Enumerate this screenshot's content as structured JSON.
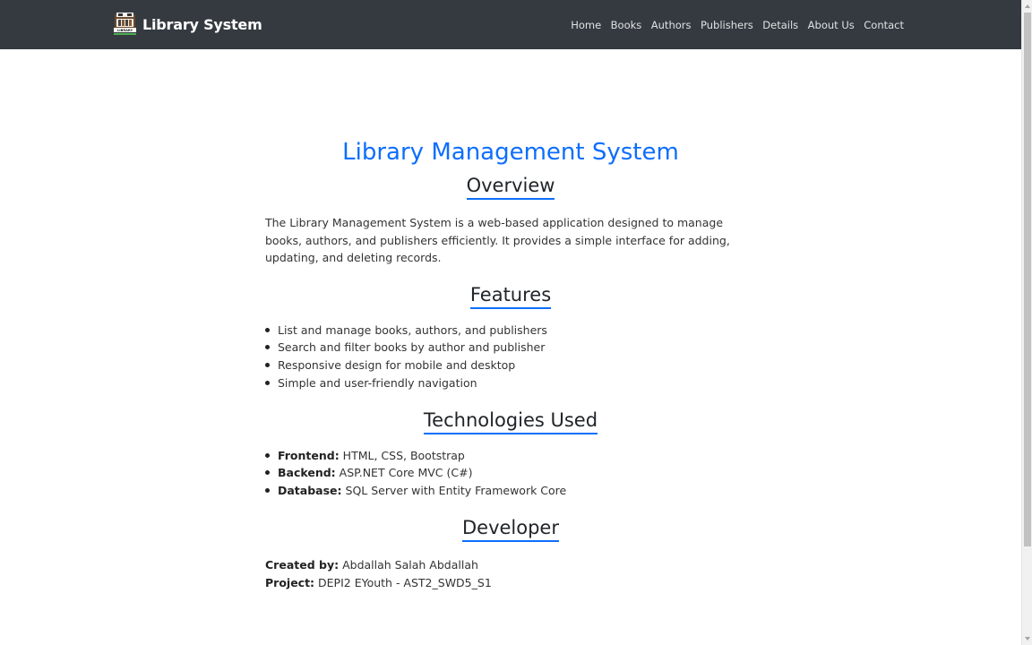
{
  "navbar": {
    "brand": "Library System",
    "brand_logo_text": "LIBRARY",
    "links": [
      "Home",
      "Books",
      "Authors",
      "Publishers",
      "Details",
      "About Us",
      "Contact"
    ]
  },
  "main": {
    "title": "Library Management System",
    "overview": {
      "heading": "Overview",
      "text": "The Library Management System is a web-based application designed to manage books, authors, and publishers efficiently. It provides a simple interface for adding, updating, and deleting records."
    },
    "features": {
      "heading": "Features",
      "items": [
        "List and manage books, authors, and publishers",
        "Search and filter books by author and publisher",
        "Responsive design for mobile and desktop",
        "Simple and user-friendly navigation"
      ]
    },
    "technologies": {
      "heading": "Technologies Used",
      "items": [
        {
          "label": "Frontend:",
          "value": " HTML, CSS, Bootstrap"
        },
        {
          "label": "Backend:",
          "value": " ASP.NET Core MVC (C#)"
        },
        {
          "label": "Database:",
          "value": " SQL Server with Entity Framework Core"
        }
      ]
    },
    "developer": {
      "heading": "Developer",
      "created_label": "Created by:",
      "created_value": " Abdallah Salah Abdallah",
      "project_label": "Project:",
      "project_value": " DEPI2 EYouth - AST2_SWD5_S1"
    }
  },
  "colors": {
    "navbar_bg": "#343a40",
    "accent": "#0d6efd",
    "text": "#333333"
  }
}
